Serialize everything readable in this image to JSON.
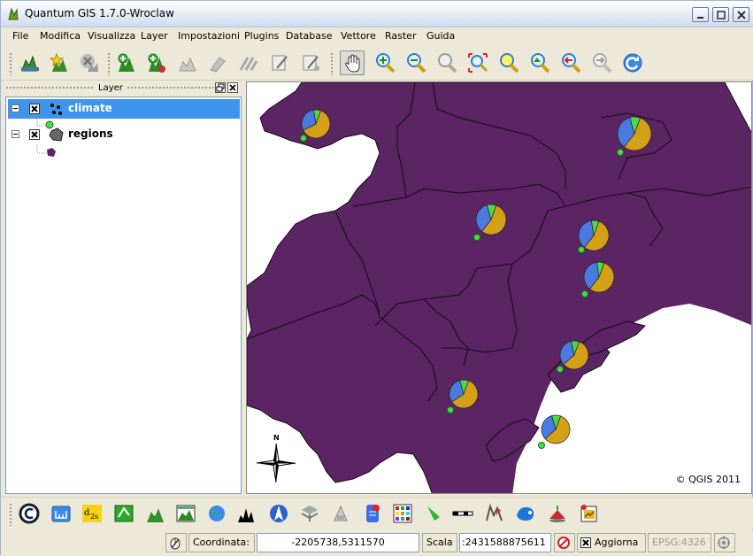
{
  "window": {
    "title": "Quantum GIS 1.7.0-Wroclaw"
  },
  "menubar": {
    "items": [
      "File",
      "Modifica",
      "Visualizza",
      "Layer",
      "Impostazioni",
      "Plugins",
      "Database",
      "Vettore",
      "Raster",
      "Guida"
    ]
  },
  "toolbar": {
    "icons": [
      "add-vector-layer-icon",
      "add-raster-layer-icon",
      "remove-layer-icon",
      "new-shapefile-icon",
      "new-spatialite-icon",
      "add-feature-icon",
      "move-feature-icon",
      "node-tool-icon",
      "cut-features-icon",
      "paste-features-icon",
      "pan-icon",
      "zoom-in-icon",
      "zoom-out-icon",
      "zoom-actual-icon",
      "zoom-full-icon",
      "zoom-selection-icon",
      "zoom-layer-icon",
      "zoom-last-icon",
      "zoom-next-icon",
      "refresh-icon"
    ]
  },
  "layer_panel": {
    "title": "Layer",
    "layers": [
      {
        "name": "climate",
        "checked": true,
        "selected": true
      },
      {
        "name": "regions",
        "checked": true,
        "selected": false
      }
    ]
  },
  "map": {
    "copyright": "© QGIS 2011",
    "north_label": "N",
    "fill_color": "#5a2562",
    "pie_colors": [
      "#d4a017",
      "#4a7ae0",
      "#4cd94c"
    ]
  },
  "plugin_toolbar": {
    "icons": [
      "copyright-label-icon",
      "scale-bar-icon",
      "d2s-icon",
      "grass-icon",
      "gps-icon",
      "raster-terrain-icon",
      "georeferencer-icon",
      "profile-icon",
      "north-arrow-icon",
      "spatial-query-icon",
      "coordinate-capture-icon",
      "oracle-raster-icon",
      "interpolation-icon",
      "heatmap-icon",
      "scale-icon",
      "text-icon",
      "plugin-installer-icon",
      "dxf-icon",
      "map-tips-icon"
    ]
  },
  "statusbar": {
    "coord_label": "Coordinata:",
    "coord_value": "-2205738,5311570",
    "scale_label": "Scala",
    "scale_value": ":2431588875611",
    "render_label": "Aggiorna",
    "crs_label": "EPSG:4326"
  }
}
